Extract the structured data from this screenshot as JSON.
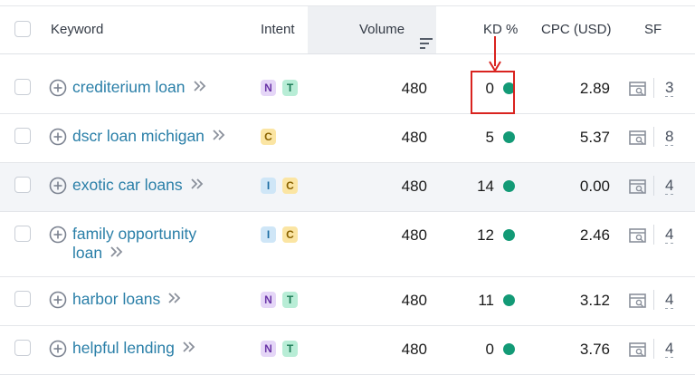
{
  "header": {
    "keyword": "Keyword",
    "intent": "Intent",
    "volume": "Volume",
    "kd": "KD %",
    "cpc": "CPC (USD)",
    "sf": "SF"
  },
  "rows": [
    {
      "keyword": "crediterium loan",
      "keyword_line2": "",
      "intents": [
        "N",
        "T"
      ],
      "volume": "480",
      "kd": "0",
      "cpc": "2.89",
      "sf": "3"
    },
    {
      "keyword": "dscr loan michigan",
      "keyword_line2": "",
      "intents": [
        "C"
      ],
      "volume": "480",
      "kd": "5",
      "cpc": "5.37",
      "sf": "8"
    },
    {
      "keyword": "exotic car loans",
      "keyword_line2": "",
      "intents": [
        "I",
        "C"
      ],
      "volume": "480",
      "kd": "14",
      "cpc": "0.00",
      "sf": "4"
    },
    {
      "keyword": "family opportunity",
      "keyword_line2": "loan",
      "intents": [
        "I",
        "C"
      ],
      "volume": "480",
      "kd": "12",
      "cpc": "2.46",
      "sf": "4"
    },
    {
      "keyword": "harbor loans",
      "keyword_line2": "",
      "intents": [
        "N",
        "T"
      ],
      "volume": "480",
      "kd": "11",
      "cpc": "3.12",
      "sf": "4"
    },
    {
      "keyword": "helpful lending",
      "keyword_line2": "",
      "intents": [
        "N",
        "T"
      ],
      "volume": "480",
      "kd": "0",
      "cpc": "3.76",
      "sf": "4"
    }
  ],
  "colors": {
    "keyword_link": "#2a7fa8",
    "kd_dot": "#139a76",
    "annotation": "#d9231f",
    "intent_N": "#e5d6f7",
    "intent_T": "#b8edd6",
    "intent_C": "#fbe5a3",
    "intent_I": "#cfe6f7"
  },
  "icons": {
    "row_add": "plus-circle-icon",
    "row_expand": "double-chevron-right-icon",
    "sort": "sort-descending-icon",
    "sf": "serp-features-icon"
  }
}
